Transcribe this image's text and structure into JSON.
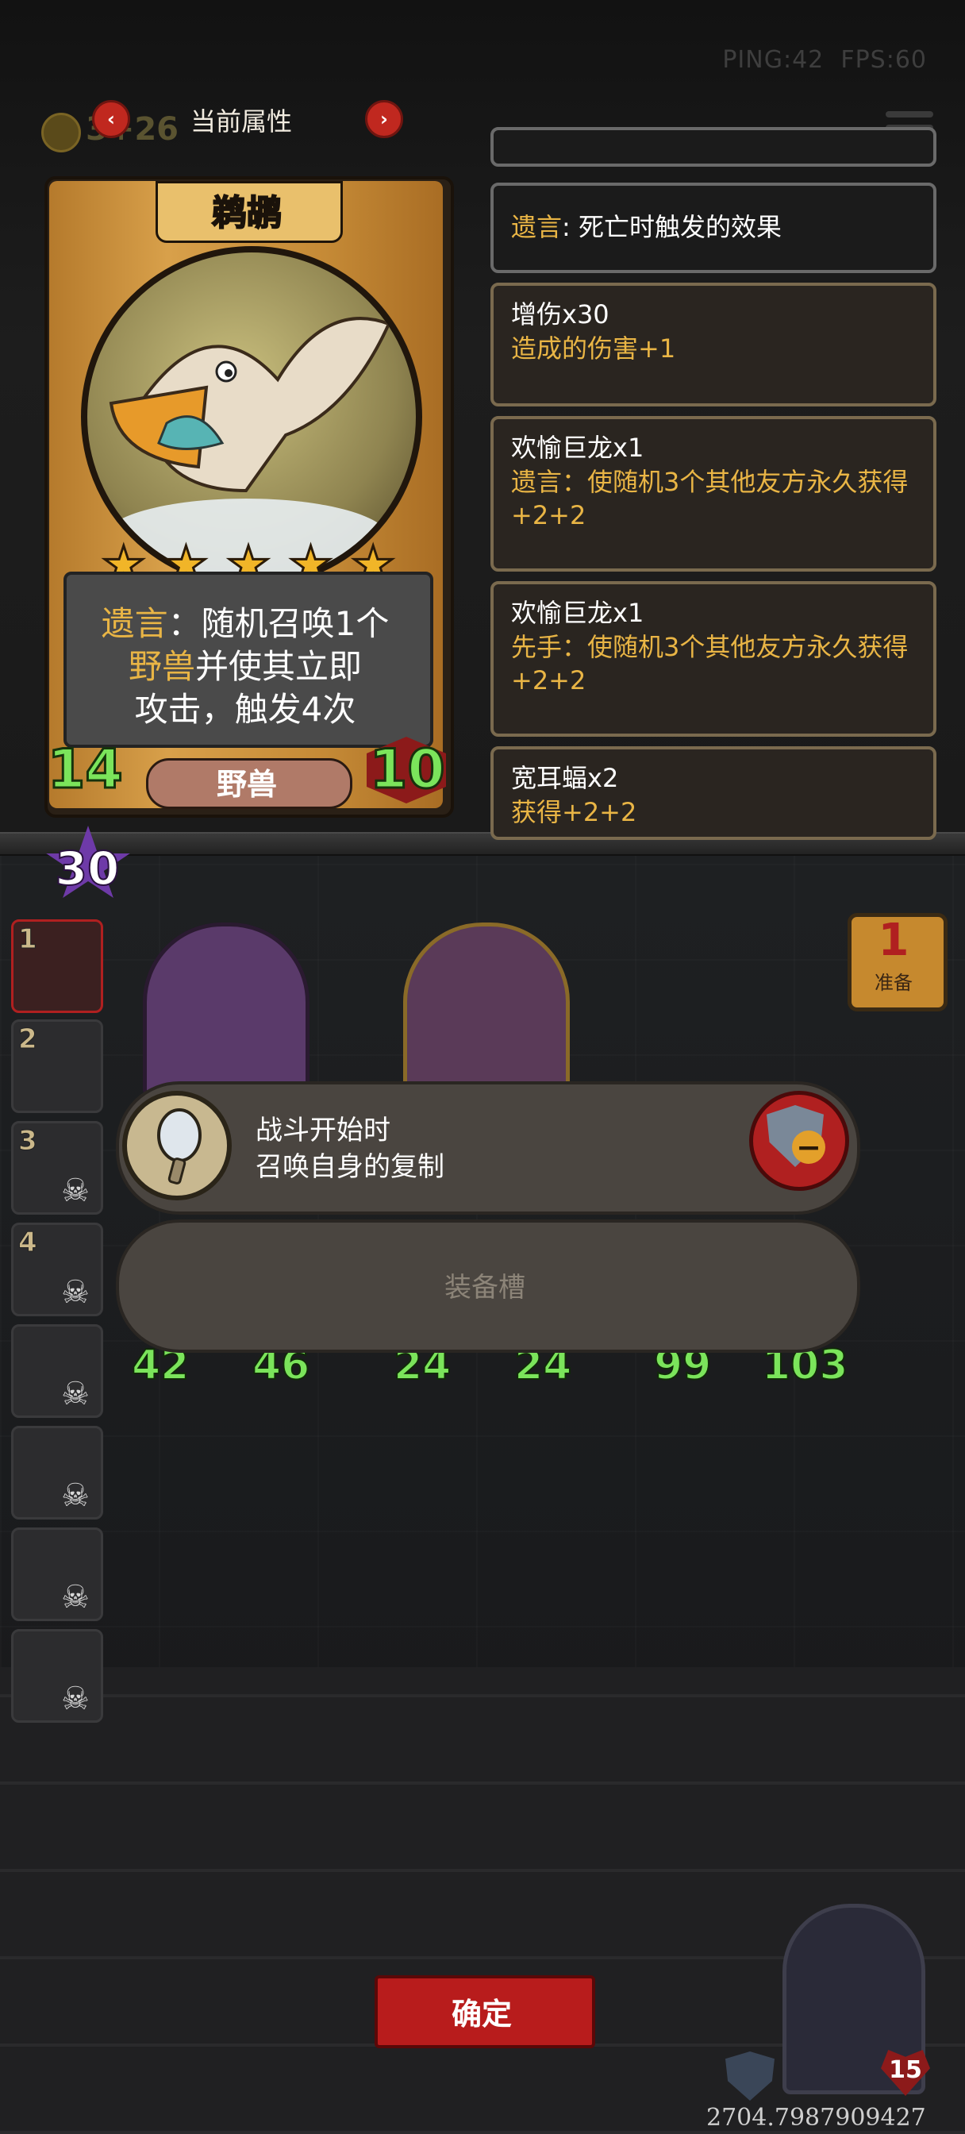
{
  "hud": {
    "ping": "PING:42",
    "fps": "FPS:60",
    "gold": "3+26"
  },
  "panel": {
    "title": "当前属性",
    "prev_icon": "‹",
    "next_icon": "›"
  },
  "card": {
    "name": "鹈鹕",
    "stars": 5,
    "desc": {
      "p1": "遗言",
      "p2": "：随机召唤1个",
      "p3": "野兽",
      "p4": "并使其立即",
      "p5": "攻击，触发4次"
    },
    "attack": "14",
    "health": "10",
    "type": "野兽",
    "tier": "30"
  },
  "effects": [
    {
      "title_kw": "遗言",
      "title_rest": ": 死亡时触发的效果"
    },
    {
      "title": "增伤x30",
      "body": "造成的伤害+1"
    },
    {
      "title": "欢愉巨龙x1",
      "body": "遗言：使随机3个其他友方永久获得+2+2"
    },
    {
      "title": "欢愉巨龙x1",
      "body": "先手：使随机3个其他友方永久获得+2+2"
    },
    {
      "title": "宽耳蝠x2",
      "body": "获得+2+2"
    }
  ],
  "team": [
    {
      "num": "1",
      "active": true
    },
    {
      "num": "2",
      "active": false
    },
    {
      "num": "3",
      "active": false
    },
    {
      "num": "4",
      "active": false
    },
    {
      "num": "",
      "active": false
    },
    {
      "num": "",
      "active": false
    },
    {
      "num": "",
      "active": false
    },
    {
      "num": "",
      "active": false
    }
  ],
  "board": {
    "minions": [
      {
        "atk": "42",
        "hp": "46"
      },
      {
        "atk": "24",
        "hp": "24"
      },
      {
        "atk": "99",
        "hp": "103"
      }
    ],
    "ready": {
      "count": "1",
      "label": "准备"
    }
  },
  "ability": {
    "line1": "战斗开始时",
    "line2": "召唤自身的复制",
    "remove_icon": "−"
  },
  "equip_slot": "装备槽",
  "confirm": "确定",
  "hero": {
    "hp": "15"
  },
  "coord": "2704.7987909427",
  "colors": {
    "accent_gold": "#e9b545",
    "stat_green": "#7be45b",
    "confirm_red": "#b81c1c"
  }
}
